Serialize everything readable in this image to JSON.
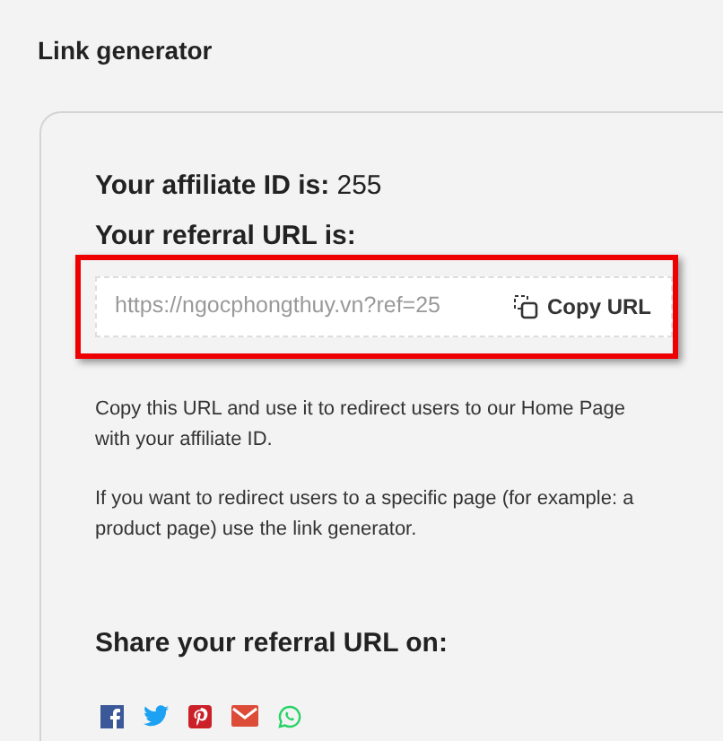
{
  "title": "Link generator",
  "affiliate": {
    "label": "Your affiliate ID is:",
    "value": "255"
  },
  "referral": {
    "label": "Your referral URL is:",
    "url": "https://ngocphongthuy.vn?ref=25",
    "copy_button": "Copy URL"
  },
  "paragraphs": [
    "Copy this URL and use it to redirect users to our Home Page with your affiliate ID.",
    "If you want to redirect users to a specific page (for example: a product page) use the link generator."
  ],
  "share": {
    "heading": "Share your referral URL on:"
  }
}
